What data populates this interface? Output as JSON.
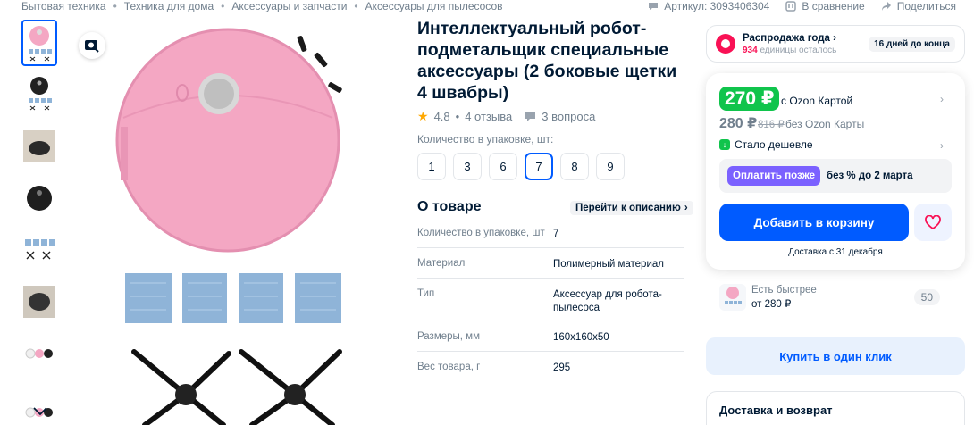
{
  "breadcrumbs": [
    "Бытовая техника",
    "Техника для дома",
    "Аксессуары и запчасти",
    "Аксессуары для пылесосов"
  ],
  "breadcrumb_sep": "•",
  "top_meta": {
    "article": "Артикул: 3093406304",
    "compare": "В сравнение",
    "share": "Поделиться"
  },
  "product": {
    "title": "Интеллектуальный робот-подметальщик специальные аксессуары (2 боковые щетки 4 швабры)",
    "rating": "4.8",
    "reviews": "4 отзыва",
    "rating_sep": "•",
    "questions": "3 вопроса",
    "pack_label": "Количество в упаковке, шт:",
    "pack_options": [
      "1",
      "3",
      "6",
      "7",
      "8",
      "9"
    ],
    "pack_selected": "7"
  },
  "about": {
    "heading": "О товаре",
    "goto_desc": "Перейти к описанию",
    "specs": [
      {
        "k": "Количество в упаковке, шт",
        "v": "7"
      },
      {
        "k": "Материал",
        "v": "Полимерный материал"
      },
      {
        "k": "Тип",
        "v": "Аксессуар для робота-пылесоса"
      },
      {
        "k": "Размеры, мм",
        "v": "160x160x50"
      },
      {
        "k": "Вес товара, г",
        "v": "295"
      }
    ]
  },
  "sale": {
    "title": "Распродажа года",
    "units": "934",
    "units_suffix": "единицы осталось",
    "days": "16 дней до конца"
  },
  "pricing": {
    "ozon_price": "270 ₽",
    "ozon_card_label": "с Ozon Картой",
    "price": "280 ₽",
    "old_price": "816 ₽",
    "no_card_label": "без Ozon Карты",
    "cheaper": "Стало дешевле",
    "pay_later_btn": "Оплатить позже",
    "pay_later_text": "без % до 2 марта",
    "add_to_cart": "Добавить в корзину",
    "delivery": "Доставка с 31 декабря"
  },
  "faster": {
    "title": "Есть быстрее",
    "price": "от 280 ₽",
    "count": "50"
  },
  "one_click": "Купить в один клик",
  "shipping_heading": "Доставка и возврат",
  "colors": {
    "accent": "#005bff",
    "green": "#10c44c",
    "sale": "#f91155",
    "purple": "#7b61ff",
    "robot_pink": "#f4a7c3"
  }
}
